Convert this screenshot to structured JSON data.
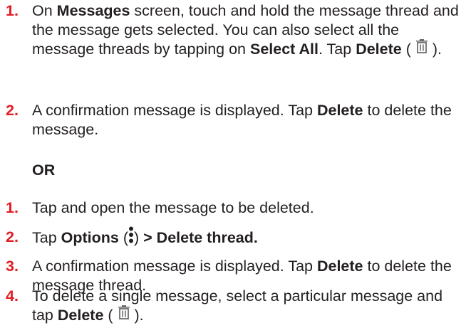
{
  "section_a": {
    "step1": {
      "num": "1.",
      "p1": "On ",
      "b1": "Messages",
      "p2": " screen, touch and hold the message thread and the message gets selected. You can also select all the message threads by tapping on ",
      "b2": "Select All",
      "p3": ". Tap ",
      "b3": "Delete",
      "p4": " ( ",
      "icon": "trash-icon",
      "p5": " )."
    },
    "step2": {
      "num": "2.",
      "p1": "A confirmation message is displayed. Tap ",
      "b1": "Delete",
      "p2": " to delete the message."
    }
  },
  "or_label": "OR",
  "section_b": {
    "step1": {
      "num": "1.",
      "p1": "Tap and open the message to be deleted."
    },
    "step2": {
      "num": "2.",
      "p1": "Tap ",
      "b1": "Options",
      "p2": " (",
      "icon": "more-vertical-icon",
      "p3": ") ",
      "b2": "> Delete thread."
    },
    "step3": {
      "num": "3.",
      "p1": "A confirmation message is displayed. Tap ",
      "b1": "Delete",
      "p2": " to delete the message thread."
    },
    "step4": {
      "num": "4.",
      "p1": "To delete a single message, select a particular message and tap ",
      "b1": "Delete",
      "p2": " ( ",
      "icon": "trash-icon",
      "p3": " )."
    }
  },
  "colors": {
    "step_number": "#e31b23",
    "text": "#231f20",
    "icon": "#6d6e70"
  }
}
